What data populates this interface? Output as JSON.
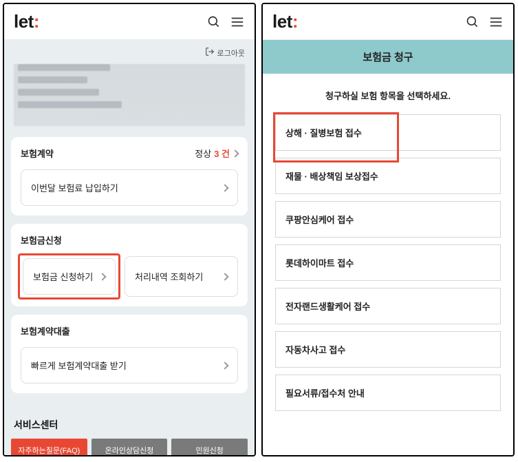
{
  "logo": {
    "let": "let",
    "colon": ":"
  },
  "screen1": {
    "logout": "로그아웃",
    "contract": {
      "title": "보험계약",
      "status_label": "정상",
      "status_count": "3 건",
      "pay_button": "이번달 보험료 납입하기"
    },
    "claim": {
      "title": "보험금신청",
      "apply_button": "보험금 신청하기",
      "history_button": "처리내역 조회하기"
    },
    "loan": {
      "title": "보험계약대출",
      "quick_loan_button": "빠르게 보험계약대출 받기"
    },
    "service_center": "서비스센터",
    "tabs": {
      "faq": "자주하는질문(FAQ)",
      "online": "온라인상담신청",
      "complaint": "민원신청"
    }
  },
  "screen2": {
    "title": "보험금 청구",
    "subtitle": "청구하실 보험 항목을 선택하세요.",
    "options": [
      "상해 · 질병보험 접수",
      "재물 · 배상책임 보상접수",
      "쿠팡안심케어 접수",
      "롯데하이마트 접수",
      "전자랜드생활케어 접수",
      "자동차사고 접수",
      "필요서류/접수처 안내"
    ]
  }
}
